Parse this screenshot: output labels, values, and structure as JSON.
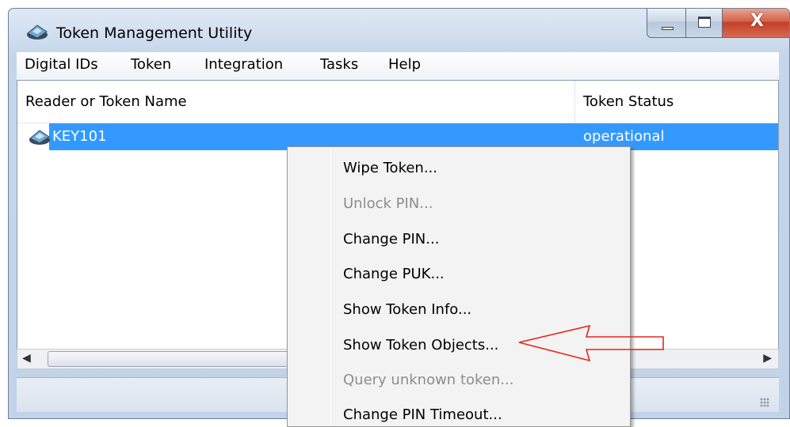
{
  "window": {
    "title": "Token Management Utility",
    "icon": "token-reader-icon",
    "controls": {
      "minimize": "minimize-icon",
      "maximize": "maximize-icon",
      "close": "X"
    }
  },
  "menubar": {
    "items": [
      "Digital IDs",
      "Token",
      "Integration",
      "Tasks",
      "Help"
    ]
  },
  "list": {
    "columns": [
      "Reader or Token Name",
      "Token Status"
    ],
    "rows": [
      {
        "name": "KEY101",
        "status": "operational",
        "selected": true
      }
    ]
  },
  "context_menu": {
    "items": [
      {
        "label": "Wipe Token...",
        "enabled": true
      },
      {
        "label": "Unlock PIN...",
        "enabled": false
      },
      {
        "label": "Change PIN...",
        "enabled": true
      },
      {
        "label": "Change PUK...",
        "enabled": true
      },
      {
        "label": "Show Token Info...",
        "enabled": true
      },
      {
        "label": "Show Token Objects...",
        "enabled": true
      },
      {
        "label": "Query unknown token...",
        "enabled": false
      },
      {
        "label": "Change PIN Timeout...",
        "enabled": true
      }
    ]
  },
  "annotation": {
    "arrow_color": "#e8251c",
    "points_to": "Show Token Objects..."
  },
  "colors": {
    "selection": "#3399ff",
    "disabled_text": "#8d8d8d"
  }
}
